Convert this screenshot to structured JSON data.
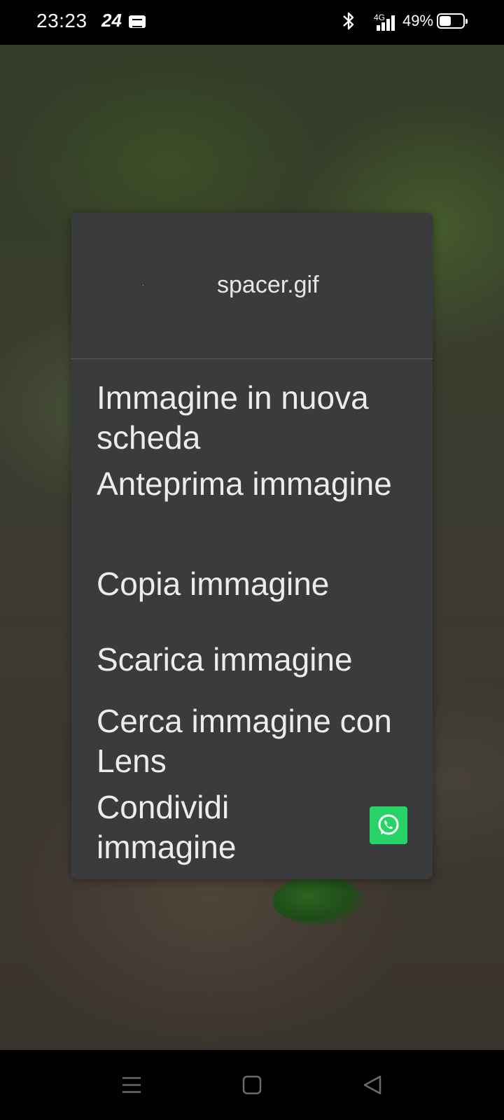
{
  "status_bar": {
    "time": "23:23",
    "app_badge": "24",
    "network": "4G",
    "battery_percent": "49%",
    "battery_level": 0.49,
    "icons": [
      "24-app-icon",
      "card-notification-icon",
      "bluetooth-icon",
      "signal-icon",
      "battery-icon"
    ]
  },
  "context_menu": {
    "title": "spacer.gif",
    "items": [
      {
        "label": "Immagine in nuova scheda"
      },
      {
        "label": "Anteprima immagine"
      },
      {
        "label": "Copia immagine"
      },
      {
        "label": "Scarica immagine"
      },
      {
        "label": "Cerca immagine con Lens"
      },
      {
        "label": "Condividi immagine"
      }
    ],
    "share_target_icon": "whatsapp-icon"
  },
  "nav_bar": {
    "icons": [
      "menu-icon",
      "home-icon",
      "back-icon"
    ]
  },
  "colors": {
    "menu_background": "#3a3b3d",
    "menu_text": "#ececec",
    "whatsapp_green": "#25d366"
  }
}
